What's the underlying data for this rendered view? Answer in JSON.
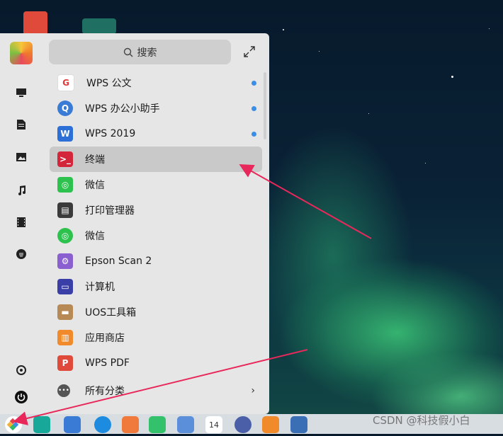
{
  "search": {
    "label": "搜索"
  },
  "apps": [
    {
      "label": "WPS 公文",
      "icon": "wps-gongwen-icon",
      "new": true
    },
    {
      "label": "WPS 办公小助手",
      "icon": "wps-assistant-icon",
      "new": true
    },
    {
      "label": "WPS 2019",
      "icon": "wps-2019-icon",
      "new": true
    },
    {
      "label": "终端",
      "icon": "terminal-icon",
      "new": false,
      "selected": true
    },
    {
      "label": "微信",
      "icon": "wechat-icon",
      "new": false
    },
    {
      "label": "打印管理器",
      "icon": "printer-icon",
      "new": false
    },
    {
      "label": "微信",
      "icon": "wechat-icon",
      "new": false
    },
    {
      "label": "Epson Scan 2",
      "icon": "epson-scan-icon",
      "new": false
    },
    {
      "label": "计算机",
      "icon": "computer-icon",
      "new": false
    },
    {
      "label": "UOS工具箱",
      "icon": "toolbox-icon",
      "new": false
    },
    {
      "label": "应用商店",
      "icon": "app-store-icon",
      "new": false
    },
    {
      "label": "WPS PDF",
      "icon": "wps-pdf-icon",
      "new": false
    }
  ],
  "all_categories": {
    "label": "所有分类"
  },
  "watermark": "CSDN @科技假小白",
  "calendar_day": "14",
  "colors": {
    "accent_dot": "#3a8ee6",
    "arrow": "#e8285a"
  }
}
